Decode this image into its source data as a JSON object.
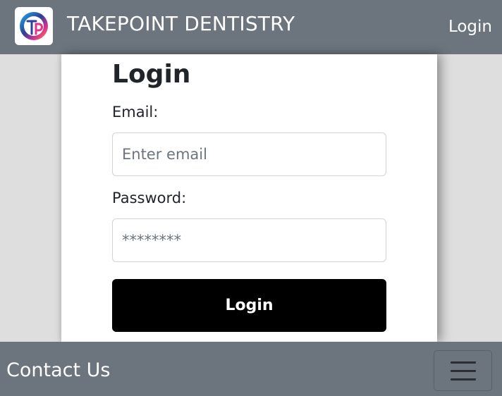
{
  "header": {
    "brand": "TAKEPOINT DENTISTRY",
    "logo_icon": "tp-logo-icon",
    "nav_login": "Login"
  },
  "login_form": {
    "title": "Login",
    "email_label": "Email:",
    "email_placeholder": "Enter email",
    "email_value": "",
    "password_label": "Password:",
    "password_placeholder": "********",
    "password_value": "",
    "submit_label": "Login"
  },
  "footer": {
    "contact_label": "Contact Us",
    "menu_icon": "hamburger-menu-icon"
  },
  "colors": {
    "navbar": "#6c757d",
    "page_background": "#dedede",
    "card": "#ffffff",
    "button": "#000000",
    "text": "#212529"
  }
}
